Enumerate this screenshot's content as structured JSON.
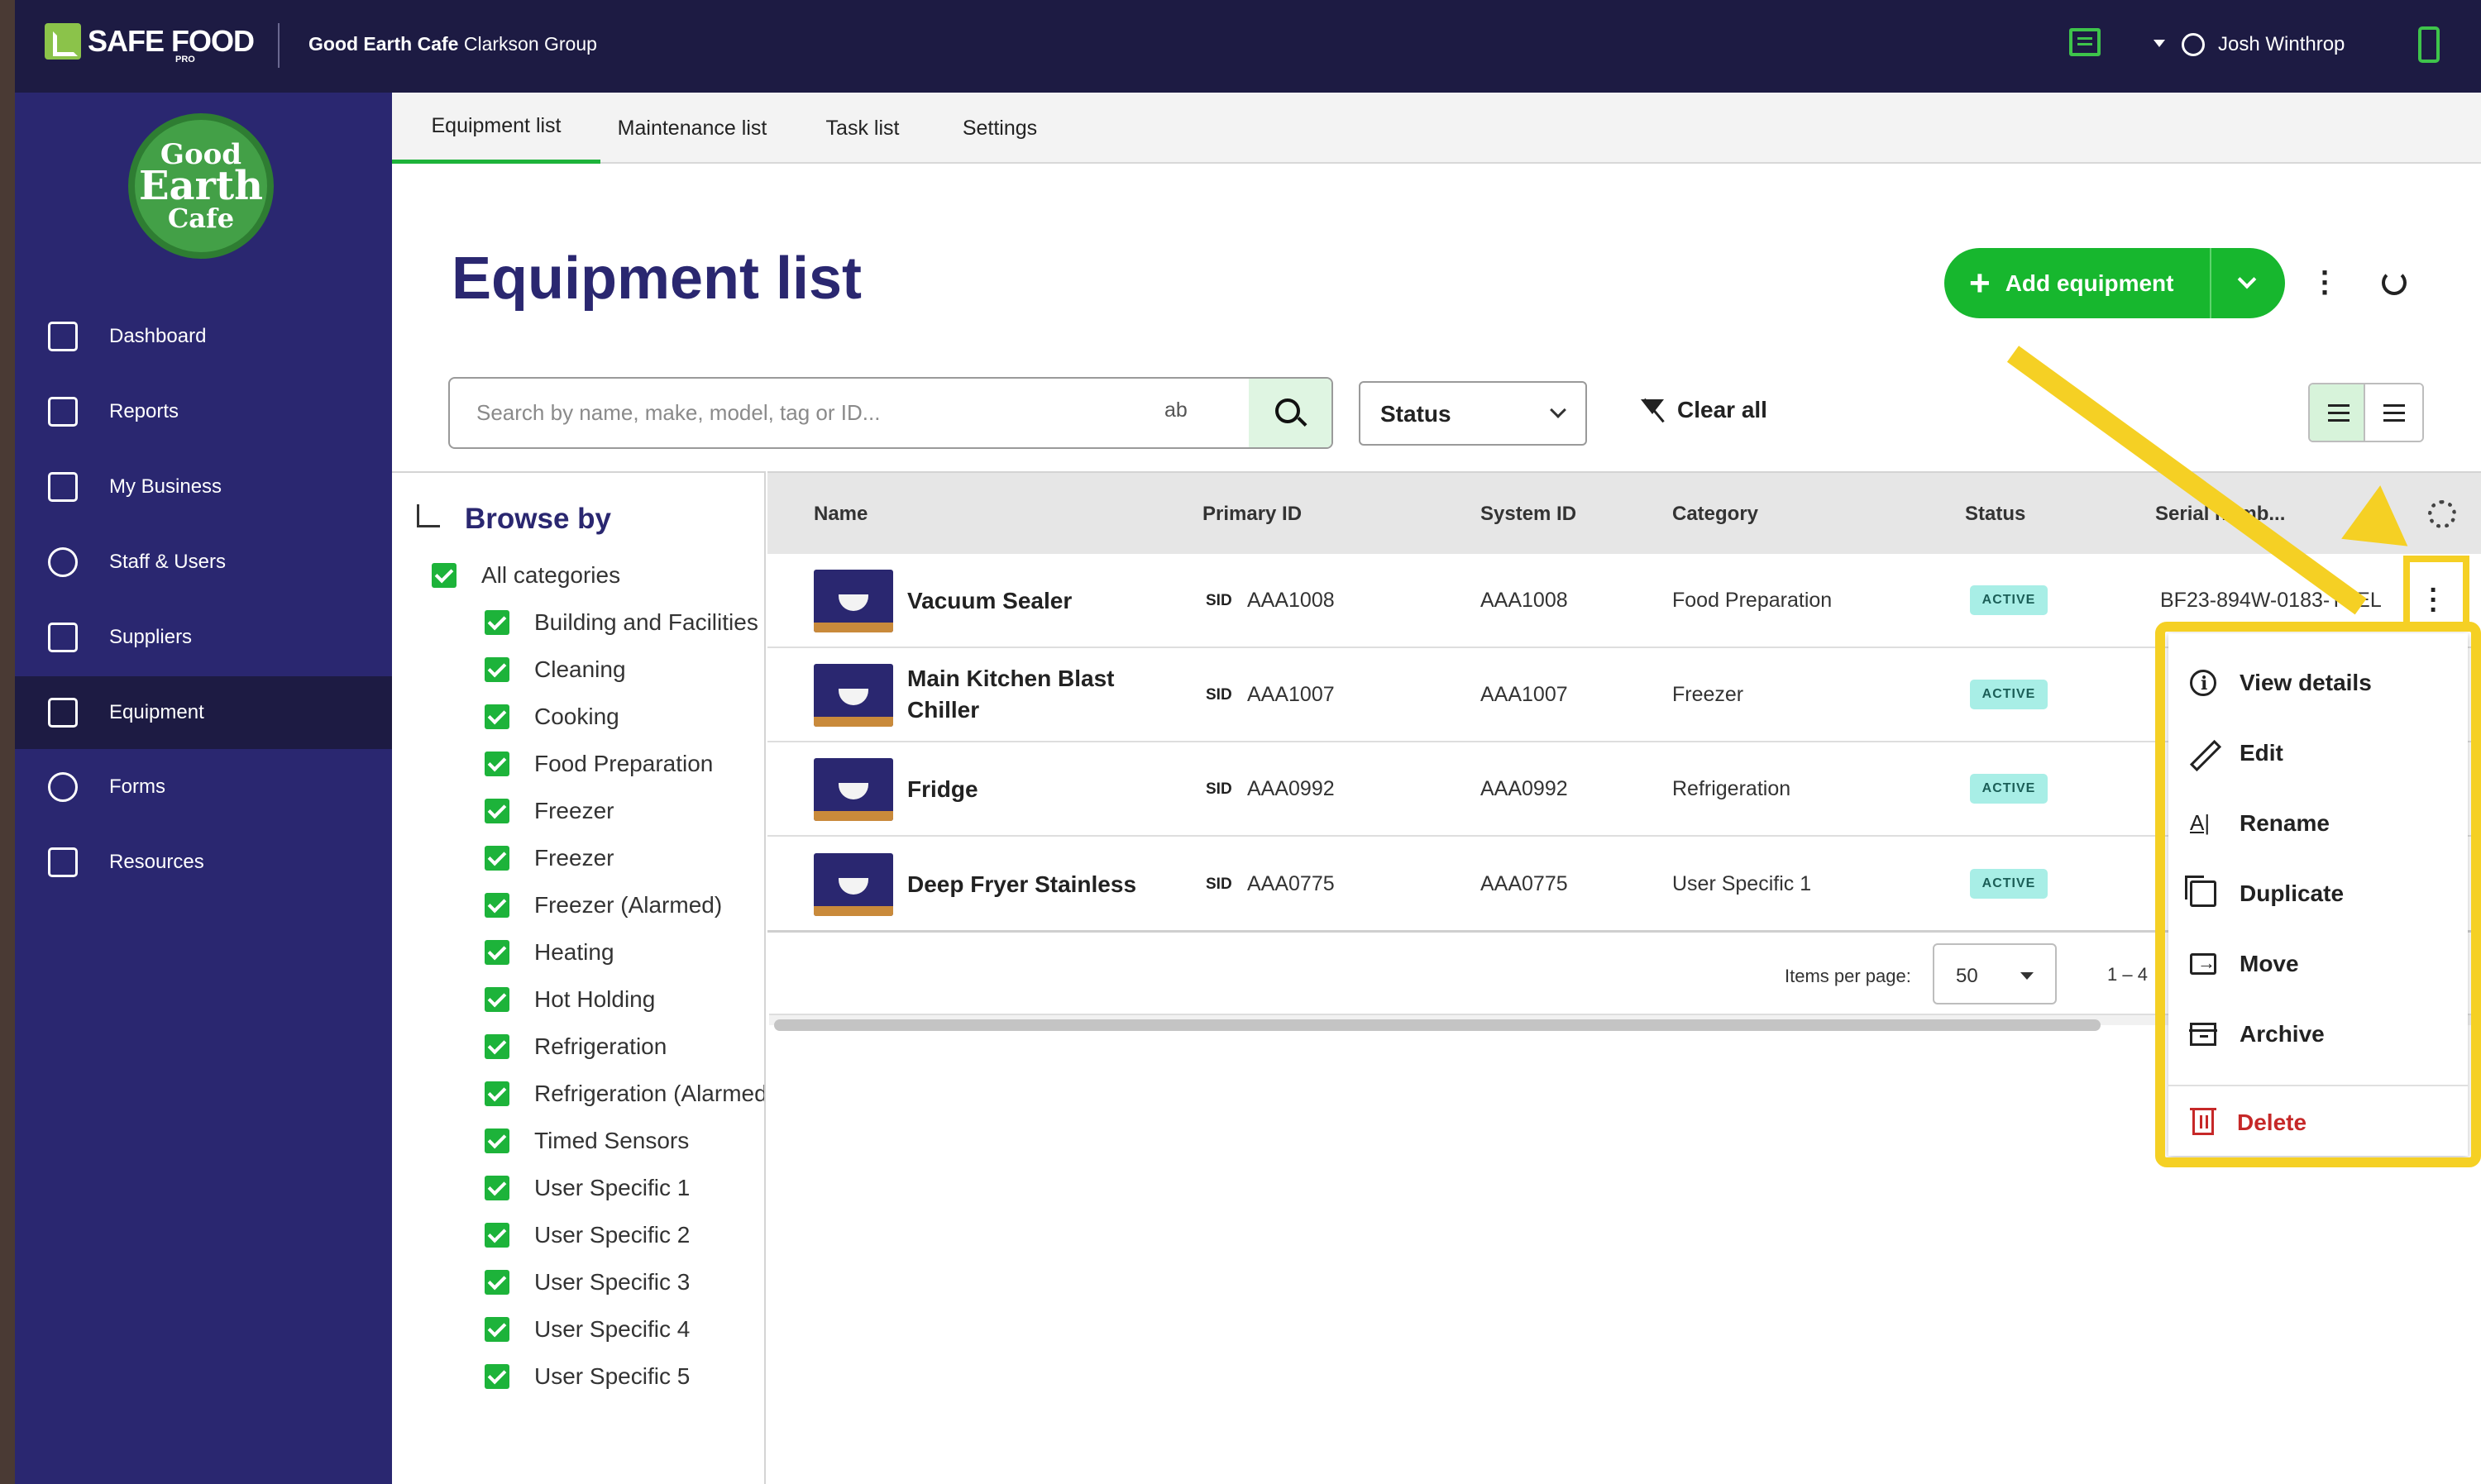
{
  "app": {
    "logo_text": "SAFE FOOD",
    "logo_sub": "PRO",
    "org_name": "Good Earth Cafe",
    "org_group": "Clarkson Group",
    "user_name": "Josh Winthrop"
  },
  "brand": {
    "line1": "Good",
    "line2": "Earth",
    "line3": "Cafe"
  },
  "sidebar": {
    "items": [
      {
        "label": "Dashboard",
        "icon": "dashboard-icon"
      },
      {
        "label": "Reports",
        "icon": "reports-icon"
      },
      {
        "label": "My Business",
        "icon": "store-icon"
      },
      {
        "label": "Staff & Users",
        "icon": "staff-icon"
      },
      {
        "label": "Suppliers",
        "icon": "truck-icon"
      },
      {
        "label": "Equipment",
        "icon": "equipment-icon",
        "active": true
      },
      {
        "label": "Forms",
        "icon": "check-circle-icon"
      },
      {
        "label": "Resources",
        "icon": "copy-icon"
      }
    ]
  },
  "tabs": [
    {
      "label": "Equipment list",
      "active": true
    },
    {
      "label": "Maintenance list"
    },
    {
      "label": "Task list"
    },
    {
      "label": "Settings"
    }
  ],
  "header": {
    "title": "Equipment list",
    "add_button": "Add equipment"
  },
  "search": {
    "placeholder": "Search by name, make, model, tag or ID...",
    "mode_icon_text": "ab"
  },
  "filters": {
    "status_label": "Status",
    "clear_all": "Clear all"
  },
  "browse": {
    "title": "Browse by",
    "all": "All categories",
    "categories": [
      "Building and Facilities",
      "Cleaning",
      "Cooking",
      "Food Preparation",
      "Freezer",
      "Freezer",
      "Freezer (Alarmed)",
      "Heating",
      "Hot Holding",
      "Refrigeration",
      "Refrigeration (Alarmed)",
      "Timed Sensors",
      "User Specific 1",
      "User Specific 2",
      "User Specific 3",
      "User Specific 4",
      "User Specific 5"
    ]
  },
  "table": {
    "columns": [
      "Name",
      "Primary ID",
      "System ID",
      "Category",
      "Status",
      "Serial numb..."
    ],
    "sid_tag": "SID",
    "rows": [
      {
        "name": "Vacuum Sealer",
        "primary_id": "AAA1008",
        "system_id": "AAA1008",
        "category": "Food Preparation",
        "status": "ACTIVE",
        "serial": "BF23-894W-0183-TSEL"
      },
      {
        "name": "Main Kitchen Blast Chiller",
        "primary_id": "AAA1007",
        "system_id": "AAA1007",
        "category": "Freezer",
        "status": "ACTIVE",
        "serial": ""
      },
      {
        "name": "Fridge",
        "primary_id": "AAA0992",
        "system_id": "AAA0992",
        "category": "Refrigeration",
        "status": "ACTIVE",
        "serial": ""
      },
      {
        "name": "Deep Fryer Stainless",
        "primary_id": "AAA0775",
        "system_id": "AAA0775",
        "category": "User Specific 1",
        "status": "ACTIVE",
        "serial": ""
      }
    ]
  },
  "pager": {
    "label": "Items per page:",
    "value": "50",
    "range": "1 – 4"
  },
  "menu": {
    "items": [
      {
        "label": "View details",
        "icon": "info-icon"
      },
      {
        "label": "Edit",
        "icon": "pencil-icon"
      },
      {
        "label": "Rename",
        "icon": "rename-icon"
      },
      {
        "label": "Duplicate",
        "icon": "duplicate-icon"
      },
      {
        "label": "Move",
        "icon": "move-icon"
      },
      {
        "label": "Archive",
        "icon": "archive-icon"
      },
      {
        "label": "Delete",
        "icon": "trash-icon"
      }
    ]
  },
  "colors": {
    "navy": "#1d1b43",
    "sidebar": "#2a2770",
    "accent_green": "#17b72e",
    "annotation_yellow": "#f5d024",
    "danger": "#c62828"
  }
}
